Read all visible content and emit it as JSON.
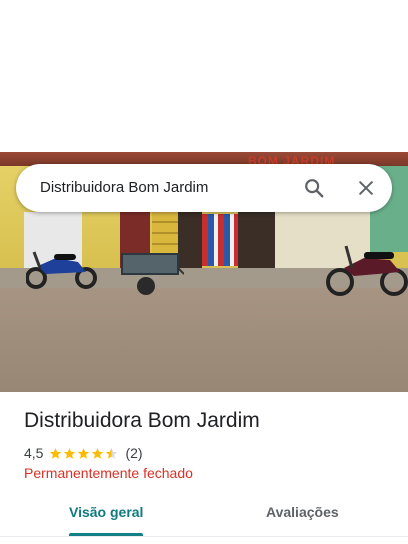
{
  "search": {
    "query": "Distribuidora Bom Jardim"
  },
  "photo": {
    "sign_text": "BOM JARDIM"
  },
  "place": {
    "name": "Distribuidora Bom Jardim",
    "rating": "4,5",
    "rating_value": 4.5,
    "rating_max": 5,
    "review_count": "(2)",
    "status": "Permanentemente fechado"
  },
  "tabs": [
    {
      "label": "Visão geral",
      "selected": true
    },
    {
      "label": "Avaliações",
      "selected": false
    }
  ],
  "colors": {
    "accent": "#137f87",
    "status_closed": "#d93025",
    "star": "#fbbc04"
  }
}
